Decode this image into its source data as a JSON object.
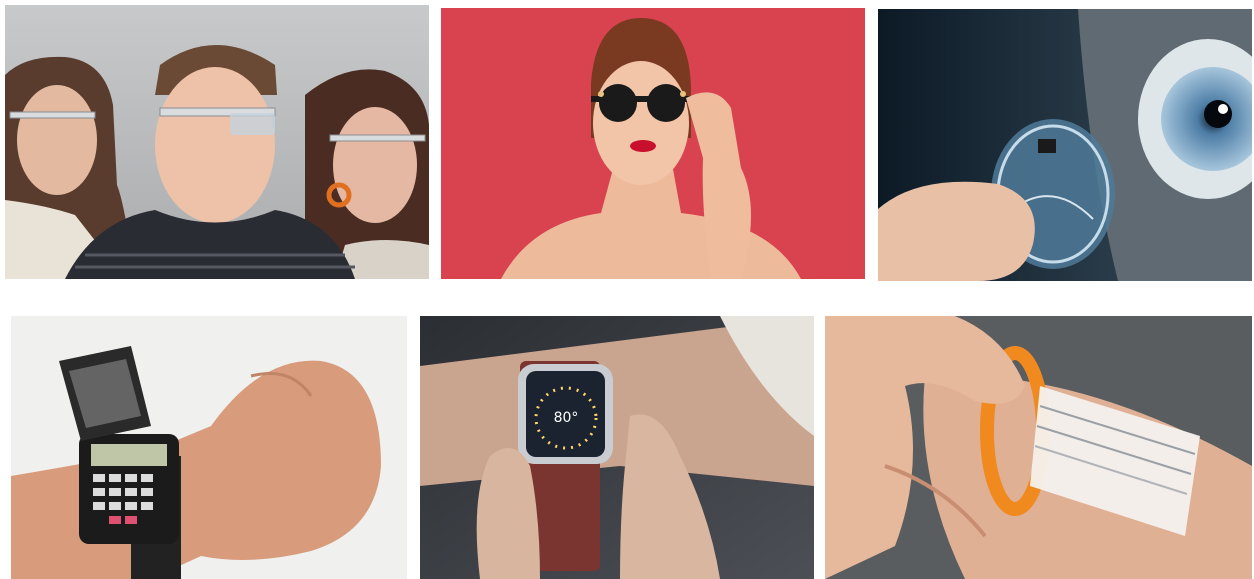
{
  "photos": [
    {
      "subject": "people-wearing-smart-glasses"
    },
    {
      "subject": "woman-wearing-camera-sunglasses"
    },
    {
      "subject": "smart-contact-lens"
    },
    {
      "subject": "calculator-wristwatch"
    },
    {
      "subject": "smartwatch-on-wrist"
    },
    {
      "subject": "projected-arm-display-bracelet"
    }
  ],
  "smartwatch": {
    "temperature": "80°"
  },
  "colors": {
    "photo2_background": "#d8434f",
    "bracelet_orange": "#f08a1f"
  }
}
